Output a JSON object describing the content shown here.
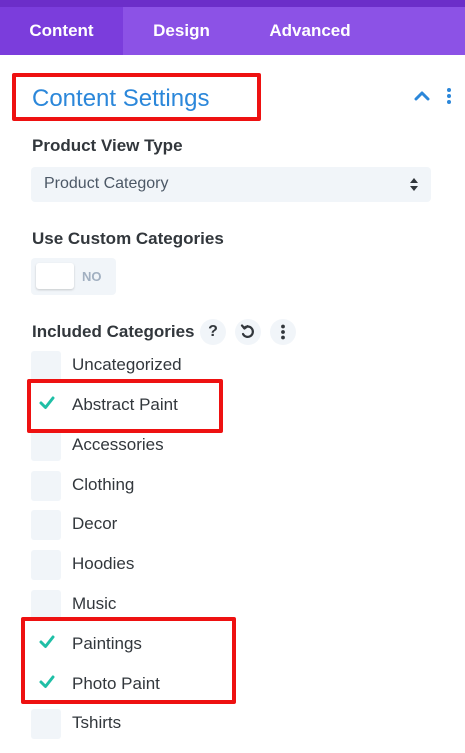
{
  "tabs": [
    {
      "label": "Content",
      "active": true
    },
    {
      "label": "Design",
      "active": false
    },
    {
      "label": "Advanced",
      "active": false
    }
  ],
  "section": {
    "title": "Content Settings",
    "collapse_icon": "chevron-up-icon",
    "more_icon": "vertical-dots-icon"
  },
  "product_view_type": {
    "label": "Product View Type",
    "value": "Product Category",
    "arrow_icon": "select-arrows-icon"
  },
  "custom_categories": {
    "label": "Use Custom Categories",
    "toggle_text": "NO",
    "enabled": false
  },
  "included_categories": {
    "label": "Included Categories",
    "help_icon": "?",
    "reset_icon": "undo-icon",
    "menu_icon": "vertical-dots-icon",
    "items": [
      {
        "label": "Uncategorized",
        "checked": false
      },
      {
        "label": "Abstract Paint",
        "checked": true
      },
      {
        "label": "Accessories",
        "checked": false
      },
      {
        "label": "Clothing",
        "checked": false
      },
      {
        "label": "Decor",
        "checked": false
      },
      {
        "label": "Hoodies",
        "checked": false
      },
      {
        "label": "Music",
        "checked": false
      },
      {
        "label": "Paintings",
        "checked": true
      },
      {
        "label": "Photo Paint",
        "checked": true
      },
      {
        "label": "Tshirts",
        "checked": false
      }
    ]
  },
  "colors": {
    "tab_bar": "#8c52e6",
    "tab_active": "#7b3ddc",
    "title_blue": "#2b87da",
    "check_teal": "#1fbfa6",
    "highlight_red": "#ee1111"
  }
}
